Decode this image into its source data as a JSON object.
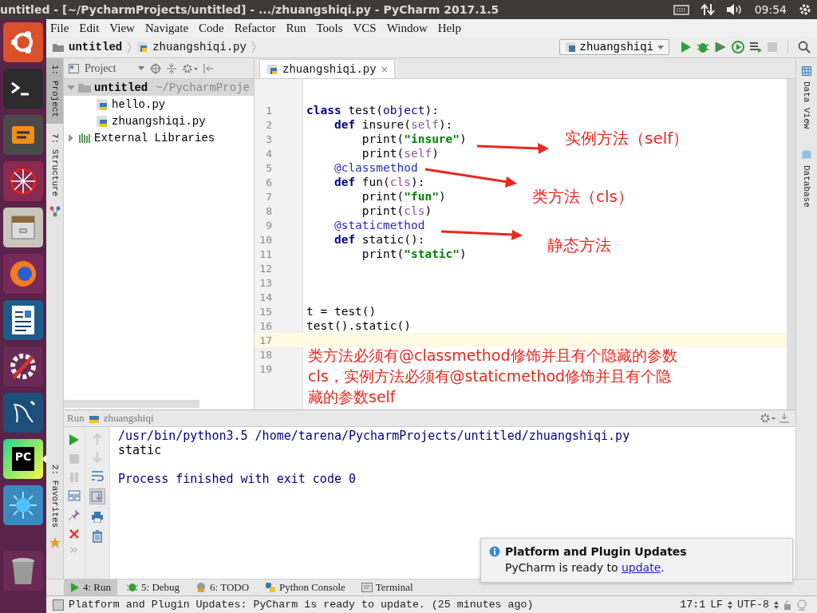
{
  "top_bar": {
    "title": "untitled - [~/PycharmProjects/untitled] - .../zhuangshiqi.py - PyCharm 2017.1.5",
    "time": "09:54"
  },
  "launcher": [
    {
      "kind": "ubuntu",
      "active": false
    },
    {
      "kind": "terminal",
      "active": false
    },
    {
      "kind": "editor",
      "active": false
    },
    {
      "kind": "web",
      "active": false
    },
    {
      "kind": "drawer",
      "active": false
    },
    {
      "kind": "browser",
      "active": false
    },
    {
      "kind": "document",
      "active": false
    },
    {
      "kind": "tools",
      "active": false
    },
    {
      "kind": "dolphin",
      "active": false
    },
    {
      "kind": "pc",
      "active": true,
      "label": "PC"
    },
    {
      "kind": "splash",
      "active": false
    },
    {
      "kind": "trash",
      "active": false
    }
  ],
  "menu": [
    "File",
    "Edit",
    "View",
    "Navigate",
    "Code",
    "Refactor",
    "Run",
    "Tools",
    "VCS",
    "Window",
    "Help"
  ],
  "nav": {
    "breadcrumbs": [
      "untitled",
      "zhuangshiqi.py"
    ],
    "run_config": "zhuangshiqi"
  },
  "left_strip": [
    {
      "label": "1: Project",
      "selected": true
    },
    {
      "label": "7: Structure",
      "selected": false
    },
    {
      "label": "2: Favorites",
      "selected": false
    }
  ],
  "right_strip": [
    {
      "label": "Data View",
      "selected": false
    },
    {
      "label": "Database",
      "selected": false
    }
  ],
  "project_panel": {
    "title": "Project",
    "tree": [
      {
        "label": "untitled",
        "path": "~/PycharmProje",
        "kind": "folder",
        "expanded": true,
        "children": [
          {
            "label": "hello.py",
            "kind": "file"
          },
          {
            "label": "zhuangshiqi.py",
            "kind": "file"
          }
        ]
      },
      {
        "label": "External Libraries",
        "kind": "library",
        "expanded": false
      }
    ]
  },
  "editor": {
    "tabs": [
      {
        "label": "zhuangshiqi.py",
        "selected": true
      }
    ],
    "lines": [
      {
        "n": "1",
        "current": false,
        "tokens": [
          {
            "t": "class",
            "kind": "kw"
          },
          {
            "t": " test(",
            "kind": "plain"
          },
          {
            "t": "object",
            "kind": "builtin"
          },
          {
            "t": "):",
            "kind": "plain"
          }
        ]
      },
      {
        "n": "2",
        "current": false,
        "tokens": [
          {
            "t": "    def",
            "kind": "kw"
          },
          {
            "t": " insure(",
            "kind": "plain"
          },
          {
            "t": "self",
            "kind": "param"
          },
          {
            "t": "):",
            "kind": "plain"
          }
        ]
      },
      {
        "n": "3",
        "current": false,
        "tokens": [
          {
            "t": "        print(",
            "kind": "plain"
          },
          {
            "t": "\"insure\"",
            "kind": "str"
          },
          {
            "t": ")",
            "kind": "plain"
          }
        ]
      },
      {
        "n": "4",
        "current": false,
        "tokens": [
          {
            "t": "        print(",
            "kind": "plain"
          },
          {
            "t": "self",
            "kind": "param"
          },
          {
            "t": ")",
            "kind": "plain"
          }
        ]
      },
      {
        "n": "5",
        "current": false,
        "tokens": [
          {
            "t": "    @classmethod",
            "kind": "deco"
          }
        ]
      },
      {
        "n": "6",
        "current": false,
        "tokens": [
          {
            "t": "    def",
            "kind": "kw"
          },
          {
            "t": " fun(",
            "kind": "plain"
          },
          {
            "t": "cls",
            "kind": "param"
          },
          {
            "t": "):",
            "kind": "plain"
          }
        ]
      },
      {
        "n": "7",
        "current": false,
        "tokens": [
          {
            "t": "        print(",
            "kind": "plain"
          },
          {
            "t": "\"fun\"",
            "kind": "str"
          },
          {
            "t": ")",
            "kind": "plain"
          }
        ]
      },
      {
        "n": "8",
        "current": false,
        "tokens": [
          {
            "t": "        print(",
            "kind": "plain"
          },
          {
            "t": "cls",
            "kind": "param"
          },
          {
            "t": ")",
            "kind": "plain"
          }
        ]
      },
      {
        "n": "9",
        "current": false,
        "tokens": [
          {
            "t": "    @staticmethod",
            "kind": "deco"
          }
        ]
      },
      {
        "n": "10",
        "current": false,
        "tokens": [
          {
            "t": "    def",
            "kind": "kw"
          },
          {
            "t": " static():",
            "kind": "plain"
          }
        ]
      },
      {
        "n": "11",
        "current": false,
        "tokens": [
          {
            "t": "        print(",
            "kind": "plain"
          },
          {
            "t": "\"static\"",
            "kind": "str"
          },
          {
            "t": ")",
            "kind": "plain"
          }
        ]
      },
      {
        "n": "12",
        "current": false
      },
      {
        "n": "13",
        "current": false
      },
      {
        "n": "14",
        "current": false
      },
      {
        "n": "15",
        "current": false,
        "tokens": [
          {
            "t": "t = test()",
            "kind": "plain"
          }
        ]
      },
      {
        "n": "16",
        "current": false,
        "tokens": [
          {
            "t": "test().static()",
            "kind": "plain"
          }
        ]
      },
      {
        "n": "17",
        "current": true
      },
      {
        "n": "18",
        "current": false
      },
      {
        "n": "19",
        "current": false
      }
    ]
  },
  "annotations": [
    {
      "text": "实例方法（self）"
    },
    {
      "text": "类方法（cls）"
    },
    {
      "text": "静态方法"
    }
  ],
  "note": "类方法必须有@classmethod修饰并且有个隐藏的参数cls，实例方法必须有@staticmethod修饰并且有个隐藏的参数self",
  "run_panel": {
    "title": "Run",
    "config": "zhuangshiqi",
    "output": [
      {
        "text": "/usr/bin/python3.5 /home/tarena/PycharmProjects/untitled/zhuangshiqi.py",
        "kind": "command"
      },
      {
        "text": "static",
        "kind": "stdout"
      },
      {
        "text": "Process finished with exit code 0",
        "kind": "system"
      }
    ]
  },
  "tool_tabs": [
    {
      "label": "4: Run",
      "kind": "run",
      "selected": true
    },
    {
      "label": "5: Debug",
      "kind": "debug",
      "selected": false
    },
    {
      "label": "6: TODO",
      "kind": "todo",
      "selected": false
    },
    {
      "label": "Python Console",
      "kind": "console",
      "selected": false
    },
    {
      "label": "Terminal",
      "kind": "terminal",
      "selected": false
    }
  ],
  "notification": {
    "title": "Platform and Plugin Updates",
    "text_before": "PyCharm is ready to ",
    "link": "update",
    "text_after": "."
  },
  "status_bar": {
    "message": "Platform and Plugin Updates: PyCharm is ready to update. (25 minutes ago)",
    "position": "17:1",
    "line_separator": "LF",
    "encoding": "UTF-8"
  }
}
